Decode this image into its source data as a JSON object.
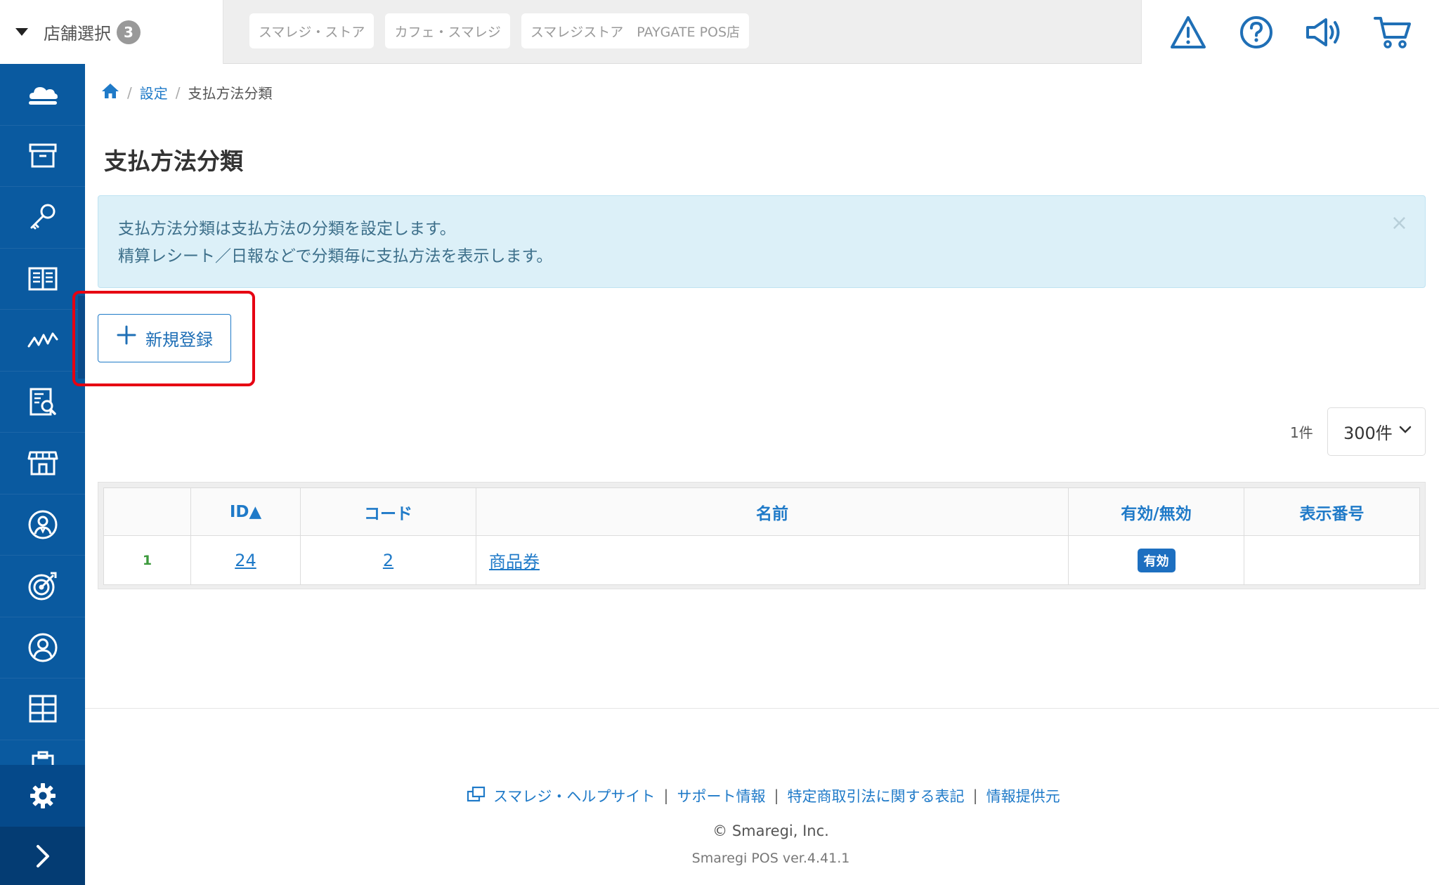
{
  "topbar": {
    "store_select": {
      "label": "店舗選択",
      "count": "3"
    },
    "store_tabs": [
      "スマレジ・ストア",
      "カフェ・スマレジ",
      "スマレジストア　PAYGATE POS店"
    ],
    "icons": [
      "warning-icon",
      "help-icon",
      "announcement-icon",
      "cart-icon"
    ]
  },
  "sidebar": {
    "items": [
      "cloud-icon",
      "archive-icon",
      "key-icon",
      "book-icon",
      "analytics-icon",
      "report-icon",
      "store-icon",
      "staff-icon",
      "target-icon",
      "customer-icon",
      "grid-icon",
      "clipboard-icon"
    ],
    "settings": "gear-icon",
    "expand": "chevron-right-icon"
  },
  "breadcrumb": {
    "settings": "設定",
    "current": "支払方法分類"
  },
  "page_title": "支払方法分類",
  "info": {
    "line1": "支払方法分類は支払方法の分類を設定します。",
    "line2": "精算レシート／日報などで分類毎に支払方法を表示します。",
    "close": "×"
  },
  "actions": {
    "new_label": "新規登録"
  },
  "list": {
    "count": "1件",
    "per_page": "300件",
    "headers": {
      "id": "ID▲",
      "code": "コード",
      "name": "名前",
      "status": "有効/無効",
      "display_no": "表示番号"
    },
    "rows": [
      {
        "num": "1",
        "id": "24",
        "code": "2",
        "name": "商品券",
        "status": "有効",
        "display_no": ""
      }
    ]
  },
  "footer": {
    "help": "スマレジ・ヘルプサイト",
    "support": "サポート情報",
    "law": "特定商取引法に関する表記",
    "provider": "情報提供元",
    "copyright": "© Smaregi, Inc.",
    "version": "Smaregi POS ver.4.41.1"
  },
  "colors": {
    "sidebar": "#0a5aa0",
    "accent": "#1f7ac8",
    "highlight": "#e60012",
    "info_bg": "#dcf0f8"
  }
}
